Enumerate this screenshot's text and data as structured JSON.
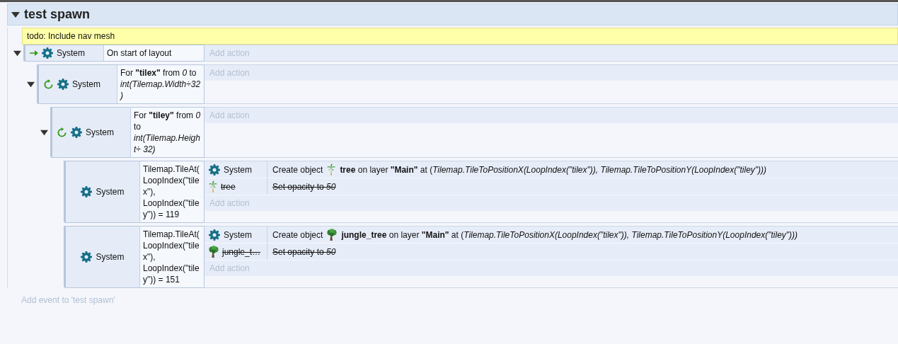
{
  "group": {
    "title": "test spawn",
    "expanded": true
  },
  "comment": "todo: Include nav mesh",
  "events": [
    {
      "expanded": true,
      "conditions": [
        {
          "kind": "trigger",
          "object": "System",
          "text": "On start of layout"
        }
      ],
      "add_action": "Add action",
      "children": [
        {
          "expanded": true,
          "conditions": [
            {
              "kind": "loop",
              "object": "System",
              "text": "For **\"tilex\"** from *0* to *int(Tilemap.Width÷32)*"
            }
          ],
          "add_action": "Add action",
          "children": [
            {
              "expanded": true,
              "conditions": [
                {
                  "kind": "loop",
                  "object": "System",
                  "text": "For **\"tiley\"** from *0* to *int(Tilemap.Height÷ 32)*"
                }
              ],
              "add_action": "Add action",
              "children": [
                {
                  "conditions": [
                    {
                      "kind": "compare",
                      "object": "System",
                      "text": "Tilemap.TileAt(LoopIndex(\"tilex\"), LoopIndex(\"tiley\")) = 119"
                    }
                  ],
                  "actions": [
                    {
                      "kind": "system",
                      "object": "System",
                      "disabled": false,
                      "text": "Create object",
                      "detail": "**tree** on layer **\"Main\"** at (*Tilemap.TileToPositionX(LoopIndex(\"tilex\")), Tilemap.TileToPositionY(LoopIndex(\"tiley\")))*"
                    },
                    {
                      "kind": "palm",
                      "object": "tree",
                      "disabled": true,
                      "text": "Set opacity to *50*"
                    }
                  ],
                  "add_action": "Add action"
                },
                {
                  "conditions": [
                    {
                      "kind": "compare",
                      "object": "System",
                      "text": "Tilemap.TileAt(LoopIndex(\"tilex\"), LoopIndex(\"tiley\")) = 151"
                    }
                  ],
                  "actions": [
                    {
                      "kind": "system",
                      "object": "System",
                      "disabled": false,
                      "text": "Create object",
                      "detail": "**jungle_tree** on layer **\"Main\"** at (*Tilemap.TileToPositionX(LoopIndex(\"tilex\")), Tilemap.TileToPositionY(LoopIndex(\"tiley\")))*"
                    },
                    {
                      "kind": "jungle",
                      "object": "jungle_t…",
                      "disabled": true,
                      "text": "Set opacity to *50*"
                    }
                  ],
                  "add_action": "Add action"
                }
              ]
            }
          ]
        }
      ]
    }
  ],
  "add_event": "Add event to 'test spawn'"
}
